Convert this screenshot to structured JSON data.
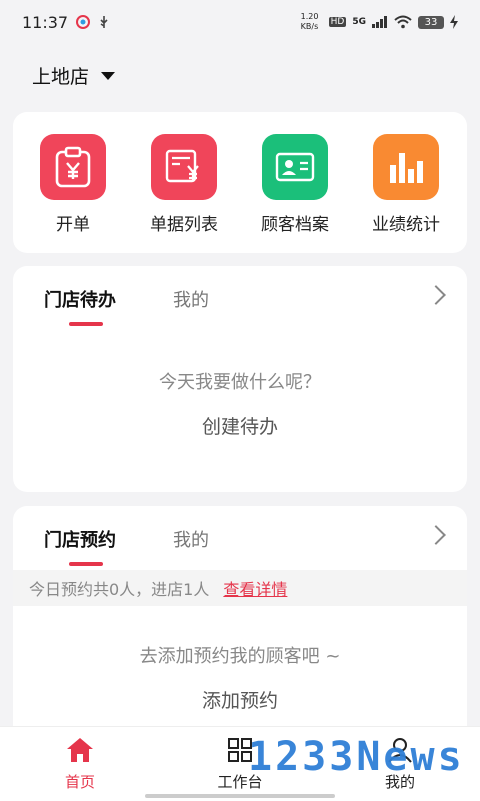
{
  "status_bar": {
    "time": "11:37",
    "net_speed": "1.20 KB/s",
    "hd": "HD",
    "network": "5G",
    "battery": "33"
  },
  "store": {
    "name": "上地店"
  },
  "quick_actions": [
    {
      "label": "开单",
      "color": "#f0455a",
      "icon": "clipboard-yen-icon"
    },
    {
      "label": "单据列表",
      "color": "#f0455a",
      "icon": "bill-yen-icon"
    },
    {
      "label": "顾客档案",
      "color": "#1bbf7a",
      "icon": "id-card-icon"
    },
    {
      "label": "业绩统计",
      "color": "#f98a32",
      "icon": "bar-chart-icon"
    }
  ],
  "todo": {
    "tab_active": "门店待办",
    "tab_inactive": "我的",
    "empty": "今天我要做什么呢？",
    "action": "创建待办"
  },
  "appointment": {
    "tab_active": "门店预约",
    "tab_inactive": "我的",
    "summary": "今日预约共0人，进店1人",
    "detail_link": "查看详情",
    "empty": "去添加预约我的顾客吧 ~",
    "action": "添加预约"
  },
  "nav": [
    {
      "label": "首页",
      "icon": "home-icon",
      "active": true
    },
    {
      "label": "工作台",
      "icon": "grid-icon",
      "active": false
    },
    {
      "label": "我的",
      "icon": "person-icon",
      "active": false
    }
  ],
  "accent": "#e5354b",
  "watermark": "1233News"
}
